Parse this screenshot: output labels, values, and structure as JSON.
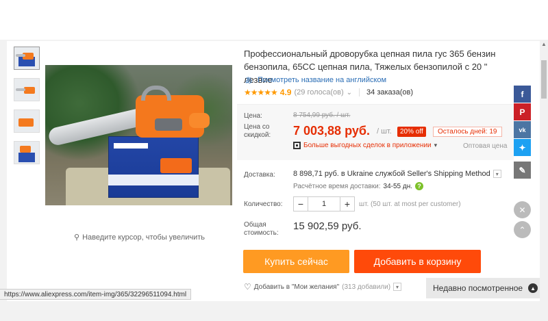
{
  "product": {
    "title": "Профессиональный дроворубка цепная пила гус 365 бензин бензопила, 65CC цепная пила, Тяжелых бензопилой с 20 \" лезвие",
    "translate_link": "Посмотреть название на английском",
    "rating": {
      "stars": "★★★★★",
      "score": "4.9",
      "votes": "(29 голоса(ов)",
      "orders": "34 заказа(ов)"
    }
  },
  "price": {
    "price_label": "Цена:",
    "old_price": "8 754,99 руб. / шт.",
    "discount_label": "Цена со скидкой:",
    "new_price": "7 003,88 руб.",
    "per_unit": "/ шт.",
    "discount_badge": "20% off",
    "days_left": "Осталось дней: 19",
    "app_deals": "Больше выгодных сделок в приложении",
    "wholesale": "Оптовая цена"
  },
  "shipping": {
    "label": "Доставка:",
    "value": "8 898,71 руб. в Ukraine службой Seller's Shipping Method",
    "estimate_label": "Расчётное время доставки:",
    "estimate_days": "34-55 дн."
  },
  "quantity": {
    "label": "Количество:",
    "value": "1",
    "note": "шт. (50 шт. at most per customer)"
  },
  "total": {
    "label": "Общая стоимость:",
    "value": "15 902,59 руб."
  },
  "actions": {
    "buy_now": "Купить сейчас",
    "add_to_cart": "Добавить в корзину",
    "wishlist": "Добавить в \"Мои желания\"",
    "wishlist_count": "(313 добавили)"
  },
  "gallery": {
    "zoom_hint": "Наведите курсор, чтобы увеличить"
  },
  "recently_viewed": "Недавно посмотренное",
  "status_url": "https://www.aliexpress.com/item-img/365/32296511094.html",
  "icons": {
    "facebook": "facebook-icon",
    "pinterest": "pinterest-icon",
    "vk": "vk-icon",
    "twitter": "twitter-icon",
    "edit": "edit-icon",
    "close": "close-icon",
    "up": "arrow-up-icon"
  },
  "colors": {
    "price_red": "#e62e04",
    "buy_orange": "#ff9a22",
    "cart_orange": "#ff4a0a",
    "star_yellow": "#ff9900",
    "link_blue": "#2a6db5"
  }
}
